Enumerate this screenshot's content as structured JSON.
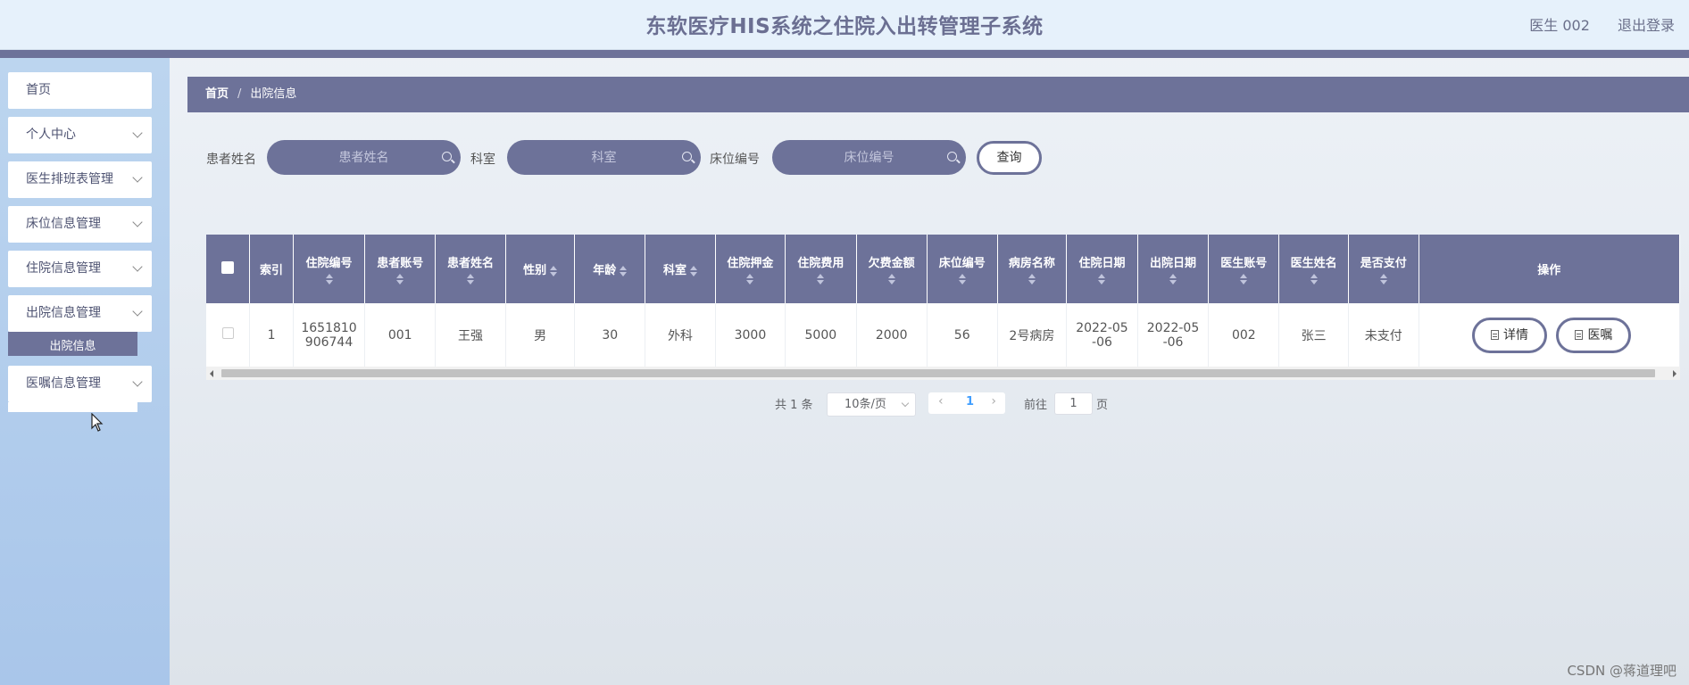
{
  "header": {
    "title": "东软医疗HIS系统之住院入出转管理子系统",
    "user": "医生 002",
    "logout": "退出登录"
  },
  "sidebar": {
    "items": [
      {
        "label": "首页"
      },
      {
        "label": "个人中心"
      },
      {
        "label": "医生排班表管理"
      },
      {
        "label": "床位信息管理"
      },
      {
        "label": "住院信息管理"
      },
      {
        "label": "出院信息管理"
      },
      {
        "label": "医嘱信息管理"
      }
    ],
    "active_sub": "出院信息"
  },
  "breadcrumb": {
    "home": "首页",
    "separator": "/",
    "current": "出院信息"
  },
  "filters": {
    "patient_name_label": "患者姓名",
    "patient_name_placeholder": "患者姓名",
    "department_label": "科室",
    "department_placeholder": "科室",
    "bed_label": "床位编号",
    "bed_placeholder": "床位编号",
    "query_button": "查询"
  },
  "table": {
    "columns": [
      {
        "label": "",
        "checkbox": true
      },
      {
        "label": "索引"
      },
      {
        "label": "住院编号"
      },
      {
        "label": "患者账号"
      },
      {
        "label": "患者姓名"
      },
      {
        "label": "性别"
      },
      {
        "label": "年龄"
      },
      {
        "label": "科室"
      },
      {
        "label": "住院押金"
      },
      {
        "label": "住院费用"
      },
      {
        "label": "欠费金额"
      },
      {
        "label": "床位编号"
      },
      {
        "label": "病房名称"
      },
      {
        "label": "住院日期"
      },
      {
        "label": "出院日期"
      },
      {
        "label": "医生账号"
      },
      {
        "label": "医生姓名"
      },
      {
        "label": "是否支付"
      },
      {
        "label": "操作"
      }
    ],
    "rows": [
      {
        "index": "1",
        "hospital_no": [
          "1651810",
          "906744"
        ],
        "patient_account": "001",
        "patient_name": "王强",
        "gender": "男",
        "age": "30",
        "department": "外科",
        "deposit": "3000",
        "cost": "5000",
        "arrears": "2000",
        "bed_no": "56",
        "ward_name": "2号病房",
        "admit_date": [
          "2022-05",
          "-06"
        ],
        "discharge_date": [
          "2022-05",
          "-06"
        ],
        "doctor_account": "002",
        "doctor_name": "张三",
        "paid": "未支付",
        "actions": [
          "详情",
          "医嘱"
        ]
      }
    ]
  },
  "pagination": {
    "total": "共 1 条",
    "page_size": "10条/页",
    "current_page": "1",
    "goto_label": "前往",
    "goto_value": "1",
    "page_suffix": "页"
  },
  "watermark": "CSDN @蒋道理吧",
  "colors": {
    "primary": "#6d7299",
    "header_bg": "#e6f1fb",
    "sidebar_bg": "#b4cdee"
  }
}
